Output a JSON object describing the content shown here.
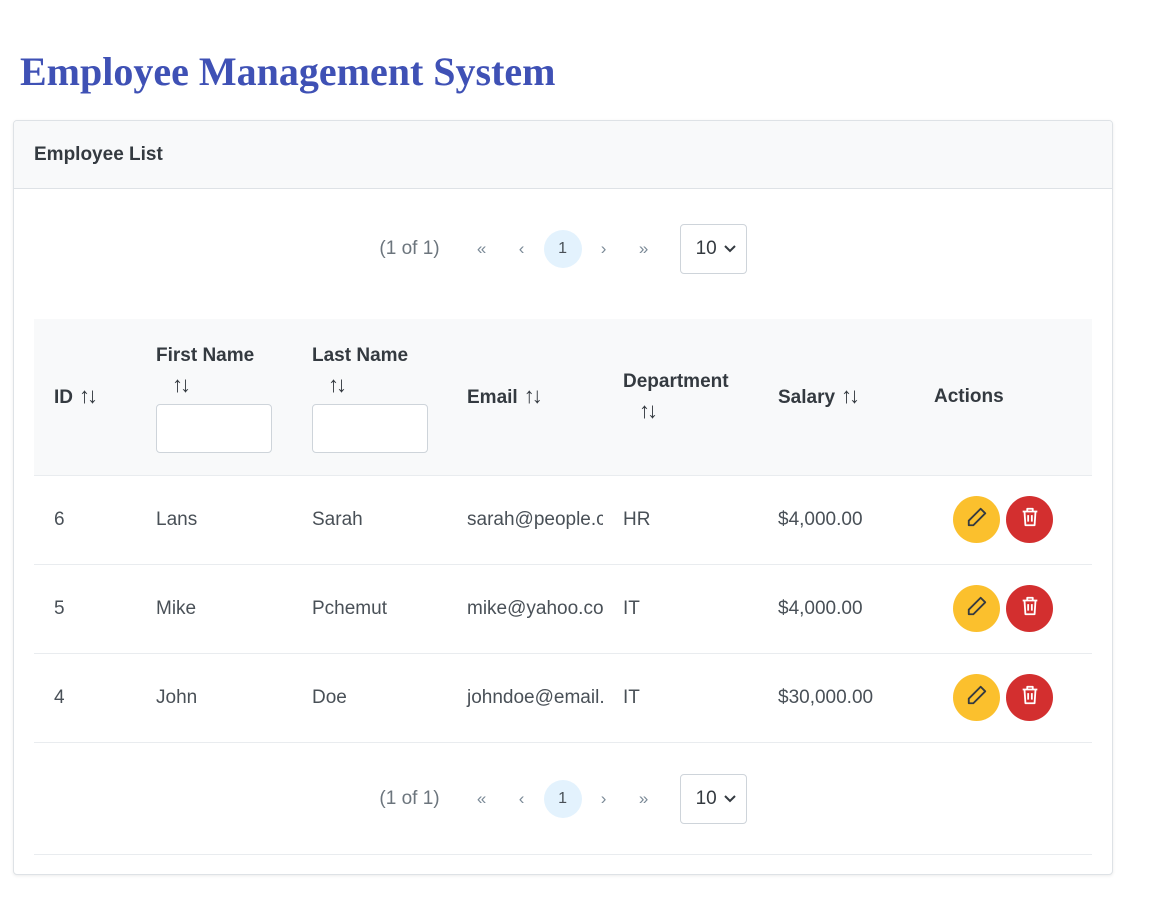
{
  "page": {
    "title": "Employee Management System"
  },
  "card": {
    "header": "Employee List"
  },
  "paginator": {
    "report": "(1 of 1)",
    "first_icon": "«",
    "prev_icon": "‹",
    "current_page": "1",
    "next_icon": "›",
    "last_icon": "»",
    "rows_per_page": "10"
  },
  "table": {
    "columns": {
      "id": "ID",
      "first_name": "First Name",
      "last_name": "Last Name",
      "email": "Email",
      "department": "Department",
      "salary": "Salary",
      "actions": "Actions"
    },
    "rows": [
      {
        "id": "6",
        "first_name": "Lans",
        "last_name": "Sarah",
        "email": "sarah@people.com",
        "department": "HR",
        "salary": "$4,000.00"
      },
      {
        "id": "5",
        "first_name": "Mike",
        "last_name": "Pchemut",
        "email": "mike@yahoo.com",
        "department": "IT",
        "salary": "$4,000.00"
      },
      {
        "id": "4",
        "first_name": "John",
        "last_name": "Doe",
        "email": "johndoe@email.com",
        "department": "IT",
        "salary": "$30,000.00"
      }
    ]
  },
  "colors": {
    "title": "#3f51b5",
    "edit": "#fbc02d",
    "delete": "#d32f2f",
    "active_page": "#e3f2fd"
  }
}
